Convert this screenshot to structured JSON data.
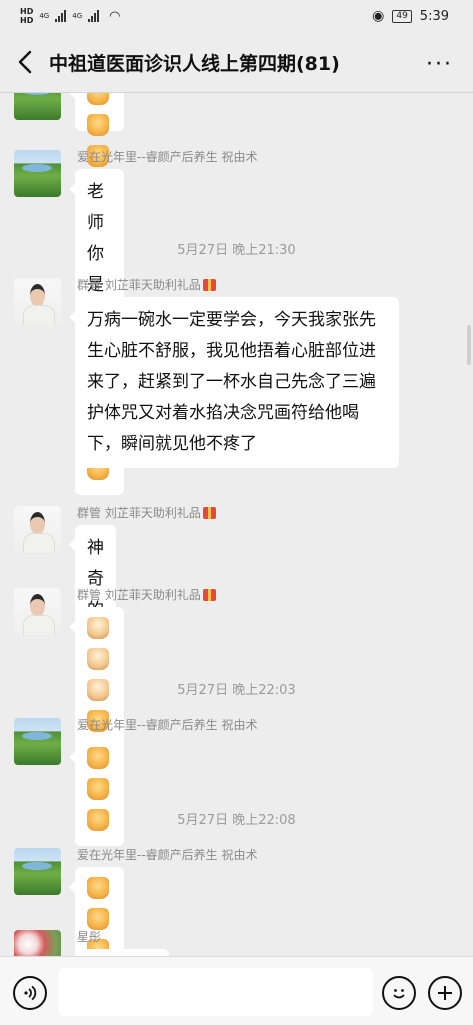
{
  "status_bar": {
    "left_labels": [
      "HD",
      "HD"
    ],
    "network_1": "4G",
    "network_2": "4G",
    "battery": "49",
    "time": "5:39"
  },
  "header": {
    "title": "中祖道医面诊识人线上第四期(81)",
    "more_label": "···"
  },
  "messages": [
    {
      "type": "msg",
      "sender": "",
      "avatar": "landscape",
      "text": "",
      "emojis": [
        "thumbs-up",
        "thumbs-up",
        "thumbs-up"
      ]
    },
    {
      "type": "msg",
      "sender": "爱在光年里--睿颜产后养生 祝由术",
      "avatar": "landscape",
      "text": "老师你是最棒的",
      "emojis": [
        "thumbs-up",
        "thumbs-up",
        "thumbs-up"
      ]
    },
    {
      "type": "time",
      "text": "5月27日 晚上21:30"
    },
    {
      "type": "msg",
      "sender": "群管 刘芷菲天助利礼品",
      "avatar": "person",
      "gift": true,
      "text": "万病一碗水一定要学会，今天我家张先生心脏不舒服，我见他捂着心脏部位进来了，赶紧到了一杯水自己先念了三遍护体咒又对着水掐决念咒画符给他喝下，瞬间就见他不疼了"
    },
    {
      "type": "msg",
      "sender": "群管 刘芷菲天助利礼品",
      "avatar": "person",
      "gift": true,
      "text": "神奇的法术"
    },
    {
      "type": "msg",
      "sender": "群管 刘芷菲天助利礼品",
      "avatar": "person",
      "gift": true,
      "text": "",
      "emojis": [
        "folded-hands",
        "folded-hands",
        "folded-hands",
        "thumbs-up",
        "thumbs-up",
        "thumbs-up"
      ]
    },
    {
      "type": "time",
      "text": "5月27日 晚上22:03"
    },
    {
      "type": "msg",
      "sender": "爱在光年里--睿颜产后养生 祝由术",
      "avatar": "landscape",
      "text": "",
      "emojis": [
        "thumbs-up",
        "thumbs-up",
        "thumbs-up"
      ]
    },
    {
      "type": "time",
      "text": "5月27日 晚上22:08"
    },
    {
      "type": "msg",
      "sender": "爱在光年里--睿颜产后养生 祝由术",
      "avatar": "landscape",
      "text": "",
      "emojis": [
        "thumbs-up",
        "thumbs-up",
        "thumbs-up"
      ]
    },
    {
      "type": "msg",
      "sender": "星彤",
      "avatar": "flower",
      "text": ""
    }
  ],
  "input_bar": {
    "voice_icon": "voice-icon",
    "emoji_icon": "emoji-icon",
    "add_icon": "add-icon"
  }
}
